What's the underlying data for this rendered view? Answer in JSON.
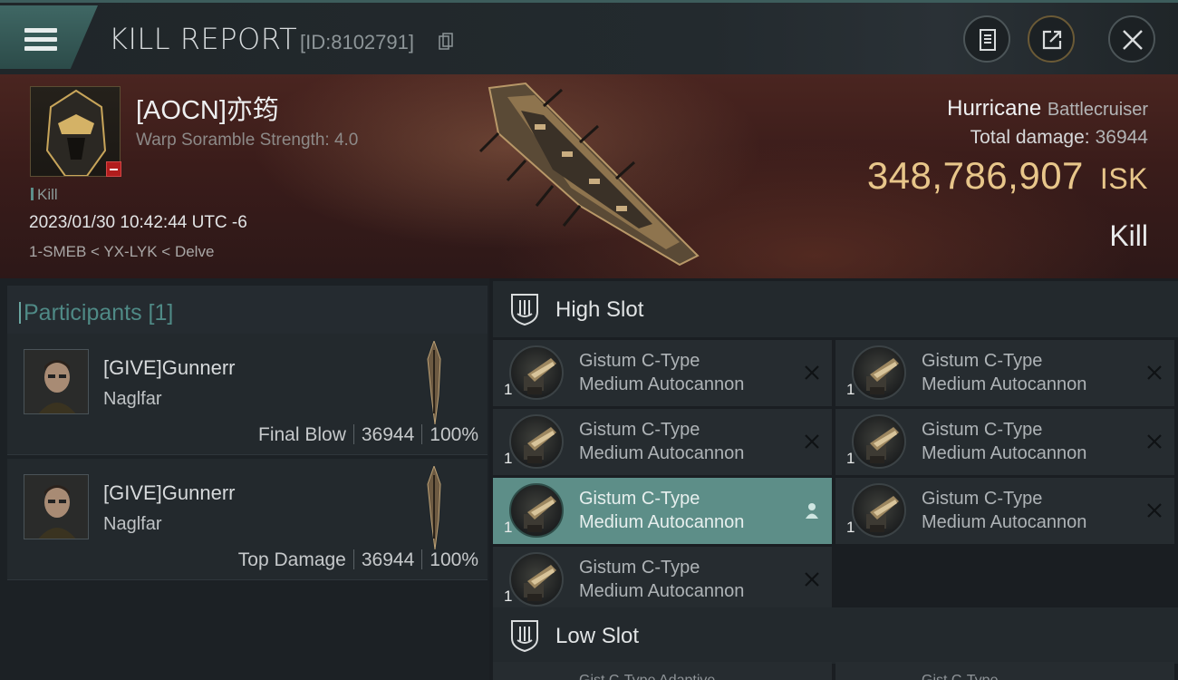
{
  "titlebar": {
    "title": "KILL REPORT",
    "kill_id": "[ID:8102791]",
    "menu_icon": "hamburger-menu-icon",
    "buttons": [
      "notes-icon",
      "share-icon",
      "close-icon"
    ]
  },
  "victim": {
    "name": "[AOCN]亦筠",
    "subtitle": "Warp Soramble Strength: 4.0",
    "kill_tag": "Kill",
    "datetime": "2023/01/30 10:42:44 UTC -6",
    "location": "1-SMEB < YX-LYK < Delve"
  },
  "ship": {
    "name": "Hurricane",
    "class": "Battlecruiser",
    "damage_label": "Total damage:",
    "damage_value": "36944",
    "isk_value": "348,786,907",
    "isk_unit": "ISK",
    "result": "Kill"
  },
  "participants": {
    "header": "Participants [1]",
    "cards": [
      {
        "name": "[GIVE]Gunnerr",
        "ship": "Naglfar",
        "label": "Final Blow",
        "damage": "36944",
        "percent": "100%"
      },
      {
        "name": "[GIVE]Gunnerr",
        "ship": "Naglfar",
        "label": "Top Damage",
        "damage": "36944",
        "percent": "100%"
      }
    ]
  },
  "high_slot": {
    "label": "High Slot",
    "modules": [
      {
        "line1": "Gistum C-Type",
        "line2": "Medium Autocannon",
        "qty": "1",
        "status": "destroyed"
      },
      {
        "line1": "Gistum C-Type",
        "line2": "Medium Autocannon",
        "qty": "1",
        "status": "destroyed"
      },
      {
        "line1": "Gistum C-Type",
        "line2": "Medium Autocannon",
        "qty": "1",
        "status": "destroyed"
      },
      {
        "line1": "Gistum C-Type",
        "line2": "Medium Autocannon",
        "qty": "1",
        "status": "destroyed"
      },
      {
        "line1": "Gistum C-Type",
        "line2": "Medium Autocannon",
        "qty": "1",
        "status": "dropped"
      },
      {
        "line1": "Gistum C-Type",
        "line2": "Medium Autocannon",
        "qty": "1",
        "status": "destroyed"
      },
      {
        "line1": "Gistum C-Type",
        "line2": "Medium Autocannon",
        "qty": "1",
        "status": "destroyed"
      }
    ]
  },
  "low_slot": {
    "label": "Low Slot",
    "peek": [
      "Gist C-Type Adaptive",
      "Gist C-Type..."
    ]
  },
  "colors": {
    "accent_teal": "#5d8e88",
    "isk_gold": "#e8c68a",
    "background": "#1a1e22"
  }
}
